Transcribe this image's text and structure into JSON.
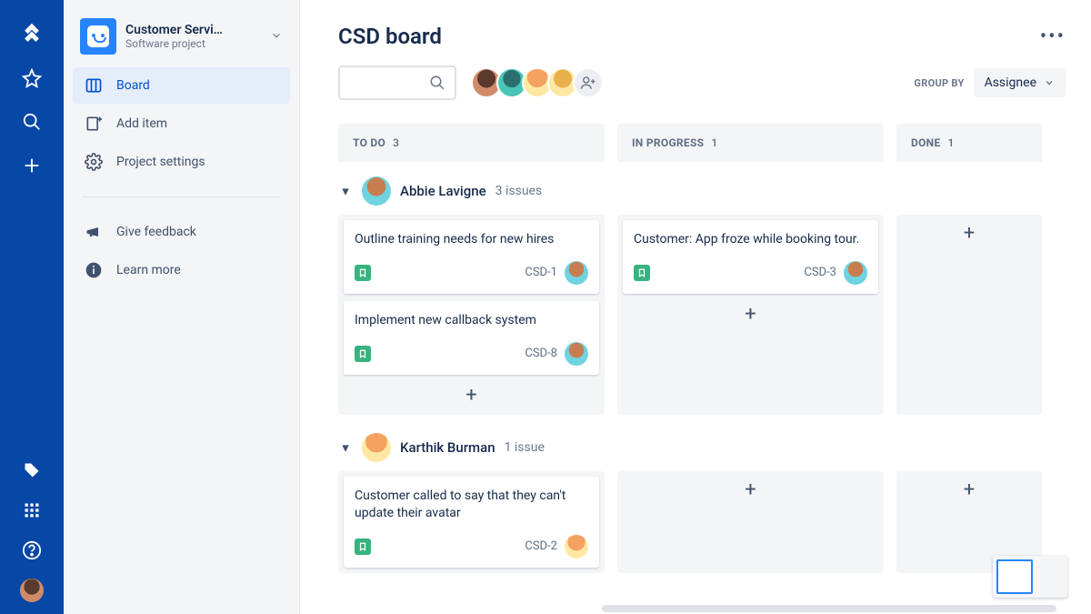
{
  "project": {
    "name": "Customer Servi…",
    "subtitle": "Software project"
  },
  "sidebar": {
    "items": [
      {
        "label": "Board"
      },
      {
        "label": "Add item"
      },
      {
        "label": "Project settings"
      }
    ],
    "secondary": [
      {
        "label": "Give feedback"
      },
      {
        "label": "Learn more"
      }
    ]
  },
  "header": {
    "title": "CSD board"
  },
  "group_by": {
    "label": "GROUP BY",
    "value": "Assignee"
  },
  "columns": [
    {
      "name": "TO DO",
      "count": "3"
    },
    {
      "name": "IN PROGRESS",
      "count": "1"
    },
    {
      "name": "DONE",
      "count": "1"
    }
  ],
  "lanes": [
    {
      "assignee": "Abbie Lavigne",
      "issue_count_text": "3 issues",
      "cells": [
        {
          "cards": [
            {
              "title": "Outline training needs for new hires",
              "key": "CSD-1"
            },
            {
              "title": "Implement new callback system",
              "key": "CSD-8"
            }
          ]
        },
        {
          "cards": [
            {
              "title": "Customer: App froze while booking tour.",
              "key": "CSD-3"
            }
          ]
        },
        {
          "cards": []
        }
      ]
    },
    {
      "assignee": "Karthik Burman",
      "issue_count_text": "1 issue",
      "cells": [
        {
          "cards": [
            {
              "title": "Customer called to say that they can't update their avatar",
              "key": "CSD-2"
            }
          ]
        },
        {
          "cards": []
        },
        {
          "cards": []
        }
      ]
    }
  ]
}
